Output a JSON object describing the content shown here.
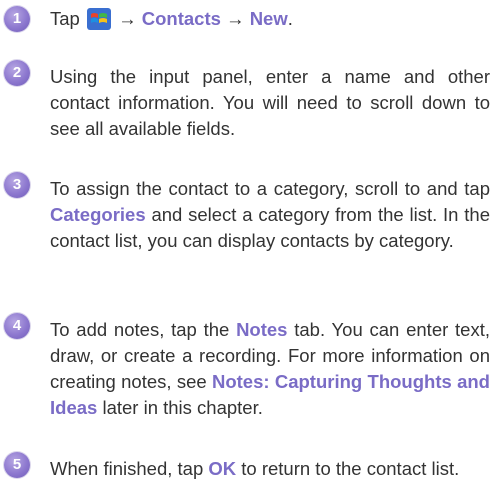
{
  "steps": [
    {
      "number": "1",
      "parts": [
        {
          "t": "Tap "
        },
        {
          "icon": "windows-start-icon"
        },
        {
          "t": " → "
        },
        {
          "t": "Contacts",
          "hl": true
        },
        {
          "t": " → "
        },
        {
          "t": "New",
          "hl": true
        },
        {
          "t": "."
        }
      ]
    },
    {
      "number": "2",
      "parts": [
        {
          "t": "Using the input panel, enter a name and other contact information. You will need to scroll down to see all available fields."
        }
      ]
    },
    {
      "number": "3",
      "parts": [
        {
          "t": "To assign the contact to a category, scroll to and tap "
        },
        {
          "t": "Categories",
          "hl": true
        },
        {
          "t": " and select a category from the list. In the contact list, you can display contacts by category."
        }
      ]
    },
    {
      "number": "4",
      "parts": [
        {
          "t": "To add notes, tap the "
        },
        {
          "t": "Notes",
          "hl": true
        },
        {
          "t": " tab. You can enter text, draw, or create a recording. For more information on creating notes, see "
        },
        {
          "t": "Notes: Capturing Thoughts and Ideas",
          "hl": true
        },
        {
          "t": " later in this chapter."
        }
      ]
    },
    {
      "number": "5",
      "parts": [
        {
          "t": "When finished, tap "
        },
        {
          "t": "OK",
          "hl": true
        },
        {
          "t": " to return to the contact list."
        }
      ]
    }
  ],
  "colors": {
    "highlight": "#7a6cc6",
    "badge": "#8d78cf",
    "text": "#333333"
  }
}
